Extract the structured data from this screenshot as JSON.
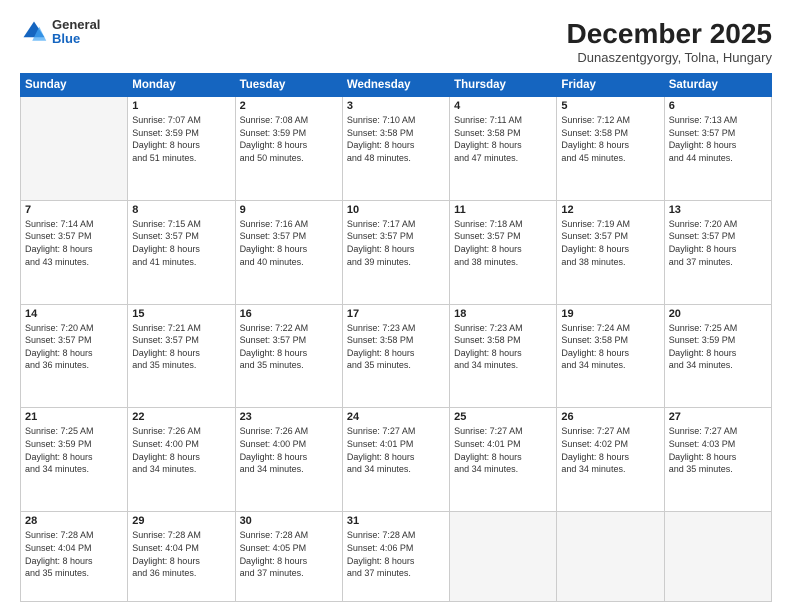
{
  "header": {
    "logo_general": "General",
    "logo_blue": "Blue",
    "month_year": "December 2025",
    "location": "Dunaszentgyorgy, Tolna, Hungary"
  },
  "days_of_week": [
    "Sunday",
    "Monday",
    "Tuesday",
    "Wednesday",
    "Thursday",
    "Friday",
    "Saturday"
  ],
  "weeks": [
    [
      {
        "day": "",
        "info": ""
      },
      {
        "day": "1",
        "info": "Sunrise: 7:07 AM\nSunset: 3:59 PM\nDaylight: 8 hours\nand 51 minutes."
      },
      {
        "day": "2",
        "info": "Sunrise: 7:08 AM\nSunset: 3:59 PM\nDaylight: 8 hours\nand 50 minutes."
      },
      {
        "day": "3",
        "info": "Sunrise: 7:10 AM\nSunset: 3:58 PM\nDaylight: 8 hours\nand 48 minutes."
      },
      {
        "day": "4",
        "info": "Sunrise: 7:11 AM\nSunset: 3:58 PM\nDaylight: 8 hours\nand 47 minutes."
      },
      {
        "day": "5",
        "info": "Sunrise: 7:12 AM\nSunset: 3:58 PM\nDaylight: 8 hours\nand 45 minutes."
      },
      {
        "day": "6",
        "info": "Sunrise: 7:13 AM\nSunset: 3:57 PM\nDaylight: 8 hours\nand 44 minutes."
      }
    ],
    [
      {
        "day": "7",
        "info": "Sunrise: 7:14 AM\nSunset: 3:57 PM\nDaylight: 8 hours\nand 43 minutes."
      },
      {
        "day": "8",
        "info": "Sunrise: 7:15 AM\nSunset: 3:57 PM\nDaylight: 8 hours\nand 41 minutes."
      },
      {
        "day": "9",
        "info": "Sunrise: 7:16 AM\nSunset: 3:57 PM\nDaylight: 8 hours\nand 40 minutes."
      },
      {
        "day": "10",
        "info": "Sunrise: 7:17 AM\nSunset: 3:57 PM\nDaylight: 8 hours\nand 39 minutes."
      },
      {
        "day": "11",
        "info": "Sunrise: 7:18 AM\nSunset: 3:57 PM\nDaylight: 8 hours\nand 38 minutes."
      },
      {
        "day": "12",
        "info": "Sunrise: 7:19 AM\nSunset: 3:57 PM\nDaylight: 8 hours\nand 38 minutes."
      },
      {
        "day": "13",
        "info": "Sunrise: 7:20 AM\nSunset: 3:57 PM\nDaylight: 8 hours\nand 37 minutes."
      }
    ],
    [
      {
        "day": "14",
        "info": "Sunrise: 7:20 AM\nSunset: 3:57 PM\nDaylight: 8 hours\nand 36 minutes."
      },
      {
        "day": "15",
        "info": "Sunrise: 7:21 AM\nSunset: 3:57 PM\nDaylight: 8 hours\nand 35 minutes."
      },
      {
        "day": "16",
        "info": "Sunrise: 7:22 AM\nSunset: 3:57 PM\nDaylight: 8 hours\nand 35 minutes."
      },
      {
        "day": "17",
        "info": "Sunrise: 7:23 AM\nSunset: 3:58 PM\nDaylight: 8 hours\nand 35 minutes."
      },
      {
        "day": "18",
        "info": "Sunrise: 7:23 AM\nSunset: 3:58 PM\nDaylight: 8 hours\nand 34 minutes."
      },
      {
        "day": "19",
        "info": "Sunrise: 7:24 AM\nSunset: 3:58 PM\nDaylight: 8 hours\nand 34 minutes."
      },
      {
        "day": "20",
        "info": "Sunrise: 7:25 AM\nSunset: 3:59 PM\nDaylight: 8 hours\nand 34 minutes."
      }
    ],
    [
      {
        "day": "21",
        "info": "Sunrise: 7:25 AM\nSunset: 3:59 PM\nDaylight: 8 hours\nand 34 minutes."
      },
      {
        "day": "22",
        "info": "Sunrise: 7:26 AM\nSunset: 4:00 PM\nDaylight: 8 hours\nand 34 minutes."
      },
      {
        "day": "23",
        "info": "Sunrise: 7:26 AM\nSunset: 4:00 PM\nDaylight: 8 hours\nand 34 minutes."
      },
      {
        "day": "24",
        "info": "Sunrise: 7:27 AM\nSunset: 4:01 PM\nDaylight: 8 hours\nand 34 minutes."
      },
      {
        "day": "25",
        "info": "Sunrise: 7:27 AM\nSunset: 4:01 PM\nDaylight: 8 hours\nand 34 minutes."
      },
      {
        "day": "26",
        "info": "Sunrise: 7:27 AM\nSunset: 4:02 PM\nDaylight: 8 hours\nand 34 minutes."
      },
      {
        "day": "27",
        "info": "Sunrise: 7:27 AM\nSunset: 4:03 PM\nDaylight: 8 hours\nand 35 minutes."
      }
    ],
    [
      {
        "day": "28",
        "info": "Sunrise: 7:28 AM\nSunset: 4:04 PM\nDaylight: 8 hours\nand 35 minutes."
      },
      {
        "day": "29",
        "info": "Sunrise: 7:28 AM\nSunset: 4:04 PM\nDaylight: 8 hours\nand 36 minutes."
      },
      {
        "day": "30",
        "info": "Sunrise: 7:28 AM\nSunset: 4:05 PM\nDaylight: 8 hours\nand 37 minutes."
      },
      {
        "day": "31",
        "info": "Sunrise: 7:28 AM\nSunset: 4:06 PM\nDaylight: 8 hours\nand 37 minutes."
      },
      {
        "day": "",
        "info": ""
      },
      {
        "day": "",
        "info": ""
      },
      {
        "day": "",
        "info": ""
      }
    ]
  ]
}
